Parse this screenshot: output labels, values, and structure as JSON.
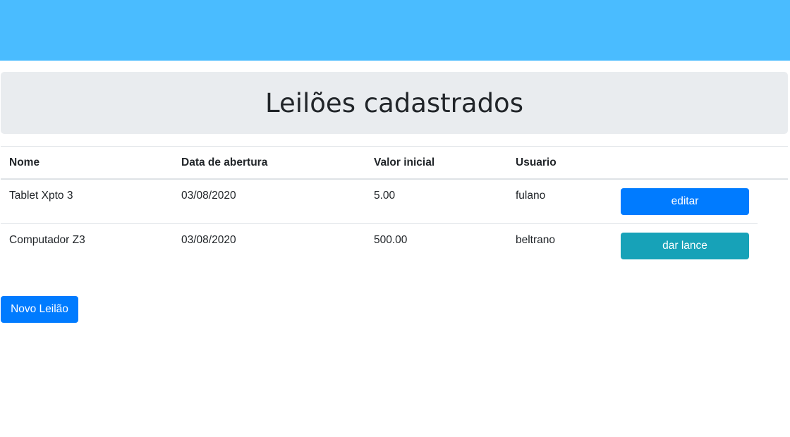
{
  "page": {
    "title": "Leilões cadastrados"
  },
  "table": {
    "headers": [
      "Nome",
      "Data de abertura",
      "Valor inicial",
      "Usuario"
    ],
    "rows": [
      {
        "nome": "Tablet Xpto 3",
        "data_abertura": "03/08/2020",
        "valor_inicial": "5.00",
        "usuario": "fulano",
        "action_label": "editar"
      },
      {
        "nome": "Computador Z3",
        "data_abertura": "03/08/2020",
        "valor_inicial": "500.00",
        "usuario": "beltrano",
        "action_label": "dar lance"
      }
    ]
  },
  "actions": {
    "new_auction_label": "Novo Leilão"
  },
  "colors": {
    "top_bar": "#4abcff",
    "jumbotron": "#e9ecef",
    "primary": "#007bff",
    "info": "#17a2b8"
  }
}
